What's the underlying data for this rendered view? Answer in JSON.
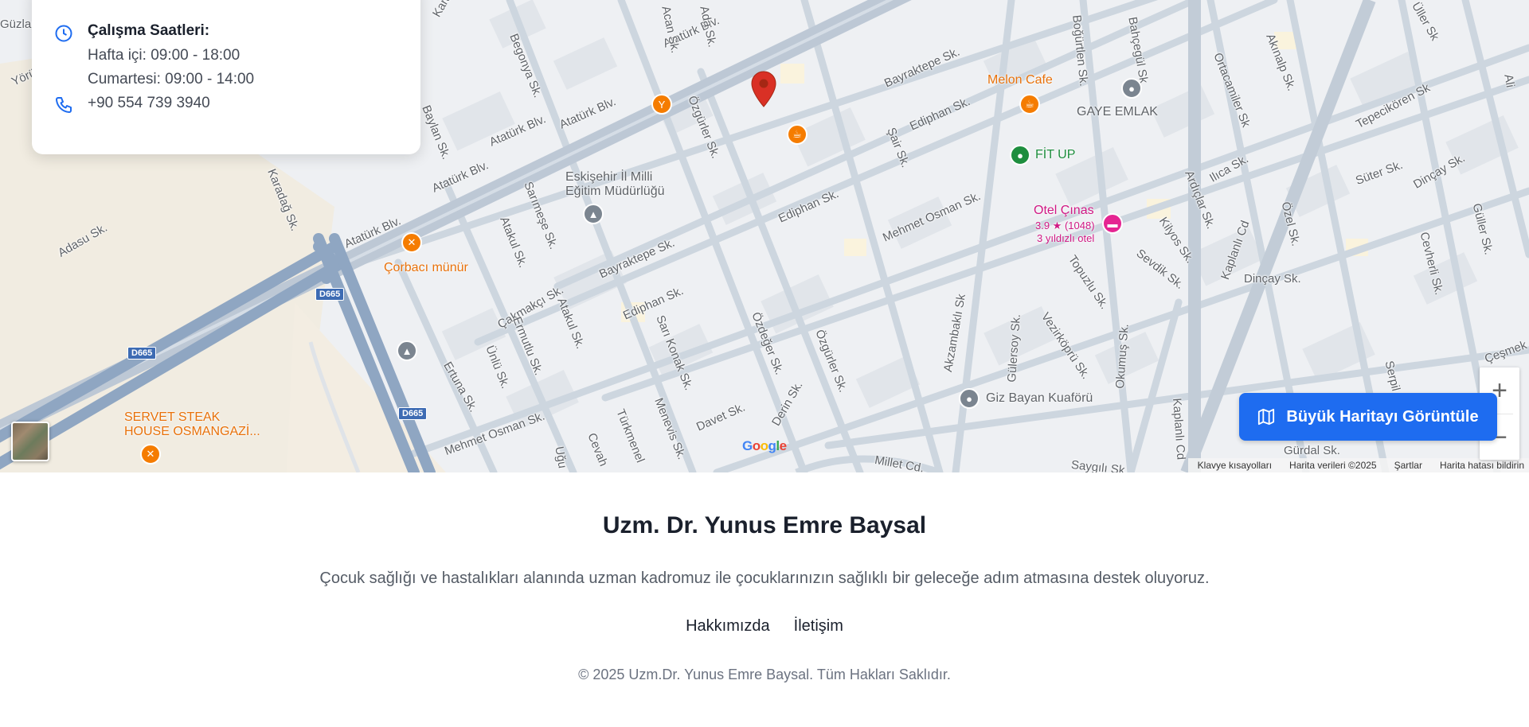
{
  "info_card": {
    "hours_title": "Çalışma Saatleri:",
    "weekdays": "Hafta içi: 09:00 - 18:00",
    "saturday": "Cumartesi: 09:00 - 14:00",
    "phone": "+90 554 739 3940"
  },
  "map": {
    "colors": {
      "road": "#c9d3de",
      "highway": "#8fa6c2",
      "block": "#dfe3e8",
      "pin": "#d93025",
      "food": "#f57c00",
      "health": "#1e8e3e",
      "hotel": "#e52592",
      "generic": "#7b8590"
    },
    "street_labels": [
      "Atatürk Blv.",
      "Atatürk Blv.",
      "Atatürk Blv.",
      "Atatürk Blv.",
      "Atatürk Blv.",
      "Bayraktepe Sk.",
      "Bayraktepe Sk.",
      "Ediphan Sk.",
      "Ediphan Sk.",
      "Ediphan Sk.",
      "Mehmet Osman Sk.",
      "Mehmet Osman Sk.",
      "Begonya Sk.",
      "Baylan Sk.",
      "Karadağ Sk.",
      "Adasu Sk.",
      "Sarımeşe Sk.",
      "Atakul Sk.",
      "Atakul Sk.",
      "Çakmakçı Sk.",
      "Ermutlu Sk.",
      "Ünlü Sk.",
      "Ertuna Sk.",
      "Sarı Konak Sk.",
      "Özdeğer Sk.",
      "Özgürler Sk.",
      "Özgürler Sk.",
      "Davet Sk.",
      "Derin Sk.",
      "Menevis Sk.",
      "Türkmenel",
      "Cevah",
      "Uğu",
      "Şair Sk.",
      "Akzambaklı Sk",
      "Gülersoy Sk.",
      "Vezirköprü Sk.",
      "Topuzlu Sk.",
      "Okumuş Sk.",
      "Sevdik Sk.",
      "Kilyos Sk.",
      "Ardıçlar Sk.",
      "Ilıca Sk.",
      "Kaplanlı Cd",
      "Kaplanlı Cd",
      "Özel Sk.",
      "Dinçay Sk.",
      "Dinçay Sk.",
      "Süter Sk.",
      "Tepecikören Sk",
      "Ortacamiler Sk",
      "Akınalp Sk.",
      "Boğürtlen Sk.",
      "Bahçegül Sk",
      "Cevherli Sk.",
      "Güller Sk.",
      "Serpil",
      "Çeşmek",
      "Gürdal Sk.",
      "Saygılı Sk.",
      "Millet Cd.",
      "Yörü",
      "Güzları",
      "Karadağ Sk.",
      "Acan Sk.",
      "Ada Sk.",
      "Üller Sk",
      "Ali"
    ],
    "highway_shields": [
      "D665",
      "D665",
      "D665"
    ],
    "pois": {
      "melon": "Melon Cafe",
      "gaye": "GAYE EMLAK",
      "fitup": "FİT UP",
      "otel": "Otel Çınas",
      "otel_rating": "3.9 ★ (1048)",
      "otel_stars": "3 yıldızlı otel",
      "eskisehir_1": "Eskişehir İl Milli",
      "eskisehir_2": "Eğitim Müdürlüğü",
      "corbaci": "Çorbacı münür",
      "servet_1": "SERVET STEAK",
      "servet_2": "HOUSE OSMANGAZİ...",
      "giz": "Giz Bayan Kuaförü"
    },
    "big_map_button": "Büyük Haritayı Görüntüle",
    "zoom_in": "+",
    "zoom_out": "−",
    "google": "Google",
    "attribution": {
      "keyboard": "Klavye kısayolları",
      "data": "Harita verileri ©2025",
      "terms": "Şartlar",
      "report": "Harita hatası bildirin"
    }
  },
  "footer": {
    "title": "Uzm. Dr. Yunus Emre Baysal",
    "description": "Çocuk sağlığı ve hastalıkları alanında uzman kadromuz ile çocuklarınızın sağlıklı bir geleceğe adım atmasına destek oluyoruz.",
    "links": [
      "Hakkımızda",
      "İletişim"
    ],
    "copyright": "© 2025 Uzm.Dr. Yunus Emre Baysal. Tüm Hakları Saklıdır."
  }
}
